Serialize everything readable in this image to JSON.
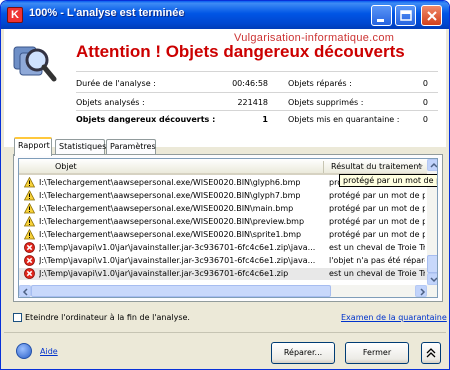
{
  "window": {
    "title": "100% - L'analyse est terminée"
  },
  "watermark": "Vulgarisation-informatique.com",
  "headline": "Attention ! Objets dangereux découverts",
  "stats": {
    "duration_label": "Durée de l'analyse :",
    "duration_value": "00:46:58",
    "analyzed_label": "Objets analysés :",
    "analyzed_value": "221418",
    "dangerous_label": "Objets dangereux découverts :",
    "dangerous_value": "1",
    "repaired_label": "Objets réparés :",
    "repaired_value": "0",
    "deleted_label": "Objets supprimés :",
    "deleted_value": "0",
    "quarantine_label": "Objets mis en quarantaine :",
    "quarantine_value": "0"
  },
  "tabs": [
    "Rapport",
    "Statistiques",
    "Paramètres"
  ],
  "table": {
    "columns": [
      "Objet",
      "Résultat du traitement"
    ],
    "rows": [
      {
        "icon": "warning-icon",
        "object": "I:\\Telechargement\\aawsepersonal.exe/WISE0020.BIN\\glyph6.bmp",
        "result": "protégé par un mot de passe, non"
      },
      {
        "icon": "warning-icon",
        "object": "I:\\Telechargement\\aawsepersonal.exe/WISE0020.BIN\\glyph7.bmp",
        "result": "protégé par un mot de pa"
      },
      {
        "icon": "warning-icon",
        "object": "I:\\Telechargement\\aawsepersonal.exe/WISE0020.BIN\\main.bmp",
        "result": "protégé par un mot de pa"
      },
      {
        "icon": "warning-icon",
        "object": "I:\\Telechargement\\aawsepersonal.exe/WISE0020.BIN\\preview.bmp",
        "result": "protégé par un mot de pa"
      },
      {
        "icon": "warning-icon",
        "object": "I:\\Telechargement\\aawsepersonal.exe/WISE0020.BIN\\sprite1.bmp",
        "result": "protégé par un mot de pa"
      },
      {
        "icon": "danger-icon",
        "object": "J:\\Temp\\javapi\\v1.0\\jar\\javainstaller.jar-3c936701-6fc4c6e1.zip\\java...",
        "result": "est un cheval de Troie Tro"
      },
      {
        "icon": "danger-icon",
        "object": "J:\\Temp\\javapi\\v1.0\\jar\\javainstaller.jar-3c936701-6fc4c6e1.zip\\java...",
        "result": "l'objet n'a pas été réparé,"
      },
      {
        "icon": "danger-icon",
        "object": "J:\\Temp\\javapi\\v1.0\\jar\\javainstaller.jar-3c936701-6fc4c6e1.zip",
        "result": "est un cheval de Troie Tro"
      }
    ],
    "tooltip": "protégé par un mot de passe, non"
  },
  "footer": {
    "shutdown_label": "Eteindre l'ordinateur à la fin de l'analyse.",
    "quarantine_link": "Examen de la quarantaine",
    "help_link": "Aide",
    "repair_button": "Réparer...",
    "close_button": "Fermer"
  },
  "colors": {
    "accent": "#cc0000",
    "titlebar": "#0055e5",
    "link": "#0033cc"
  }
}
